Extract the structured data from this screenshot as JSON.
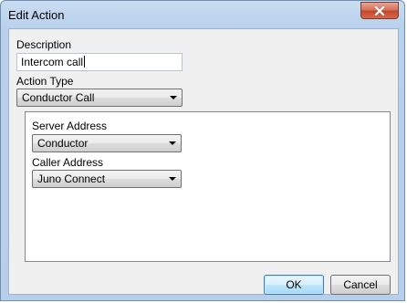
{
  "window": {
    "title": "Edit Action"
  },
  "form": {
    "description_label": "Description",
    "description_value": "Intercom call",
    "action_type_label": "Action Type",
    "action_type_value": "Conductor Call"
  },
  "panel": {
    "server_address_label": "Server Address",
    "server_address_value": "Conductor",
    "caller_address_label": "Caller Address",
    "caller_address_value": "Juno Connect"
  },
  "buttons": {
    "ok_label": "OK",
    "cancel_label": "Cancel"
  },
  "colors": {
    "title_bar": "#b9d1ec",
    "close_button": "#c4452a",
    "default_button_border": "#3c7fb1"
  },
  "icons": {
    "close": "close-icon",
    "dropdown": "chevron-down-icon"
  }
}
